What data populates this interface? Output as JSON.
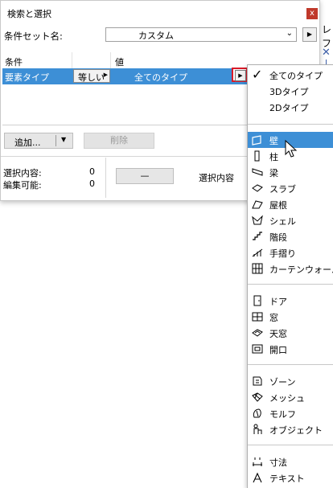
{
  "window": {
    "title": "検索と選択",
    "close_label": "x"
  },
  "criteria_set": {
    "label": "条件セット名:",
    "value": "カスタム"
  },
  "table": {
    "header_condition": "条件",
    "header_value": "値",
    "row": {
      "condition": "要素タイプ",
      "operator": "等しい",
      "value": "全てのタイプ"
    }
  },
  "buttons": {
    "add": "追加...",
    "delete": "削除",
    "dash": "—"
  },
  "stats": {
    "selection_label": "選択内容:",
    "selection_value": "0",
    "editable_label": "編集可能:",
    "editable_value": "0",
    "selection_button_label": "選択内容"
  },
  "background_app": {
    "partial_text": "レフ"
  },
  "menu": {
    "type_options": [
      {
        "label": "全てのタイプ",
        "checked": true
      },
      {
        "label": "3Dタイプ"
      },
      {
        "label": "2Dタイプ"
      }
    ],
    "group1": [
      {
        "label": "壁",
        "icon": "wall-icon",
        "highlighted": true
      },
      {
        "label": "柱",
        "icon": "column-icon"
      },
      {
        "label": "梁",
        "icon": "beam-icon"
      },
      {
        "label": "スラブ",
        "icon": "slab-icon"
      },
      {
        "label": "屋根",
        "icon": "roof-icon"
      },
      {
        "label": "シェル",
        "icon": "shell-icon"
      },
      {
        "label": "階段",
        "icon": "stair-icon"
      },
      {
        "label": "手摺り",
        "icon": "railing-icon"
      },
      {
        "label": "カーテンウォール",
        "icon": "curtain-wall-icon"
      }
    ],
    "group2": [
      {
        "label": "ドア",
        "icon": "door-icon"
      },
      {
        "label": "窓",
        "icon": "window-icon"
      },
      {
        "label": "天窓",
        "icon": "skylight-icon"
      },
      {
        "label": "開口",
        "icon": "opening-icon"
      }
    ],
    "group3": [
      {
        "label": "ゾーン",
        "icon": "zone-icon"
      },
      {
        "label": "メッシュ",
        "icon": "mesh-icon"
      },
      {
        "label": "モルフ",
        "icon": "morph-icon"
      },
      {
        "label": "オブジェクト",
        "icon": "object-icon"
      }
    ],
    "group4": [
      {
        "label": "寸法",
        "icon": "dimension-icon"
      },
      {
        "label": "テキスト",
        "icon": "text-icon"
      }
    ]
  }
}
